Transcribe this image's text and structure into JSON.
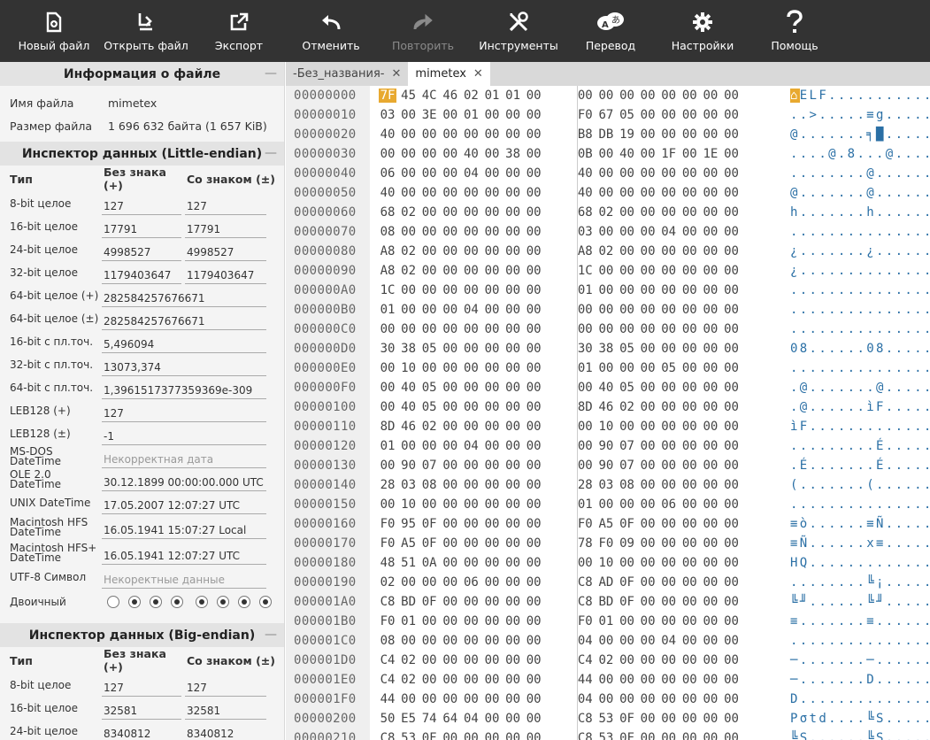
{
  "toolbar": {
    "items": [
      {
        "label": "Новый файл",
        "icon": "new-file-icon"
      },
      {
        "label": "Открыть файл",
        "icon": "open-file-icon"
      },
      {
        "label": "Экспорт",
        "icon": "export-icon"
      },
      {
        "label": "Отменить",
        "icon": "undo-icon"
      },
      {
        "label": "Повторить",
        "icon": "redo-icon"
      },
      {
        "label": "Инструменты",
        "icon": "tools-icon"
      },
      {
        "label": "Перевод",
        "icon": "translate-icon"
      },
      {
        "label": "Настройки",
        "icon": "gear-icon"
      },
      {
        "label": "Помощь",
        "icon": "help-icon"
      }
    ]
  },
  "file_info": {
    "title": "Информация о файле",
    "name_label": "Имя файла",
    "name_value": "mimetex",
    "size_label": "Размер файла",
    "size_value": "1 696 632 байта (1 657 KiB)"
  },
  "inspector_le": {
    "title": "Инспектор данных (Little-endian)",
    "col_type": "Тип",
    "col_unsigned": "Без знака (+)",
    "col_signed": "Со знаком (±)",
    "rows": [
      {
        "label": "8-bit целое",
        "u": "127",
        "s": "127"
      },
      {
        "label": "16-bit целое",
        "u": "17791",
        "s": "17791"
      },
      {
        "label": "24-bit целое",
        "u": "4998527",
        "s": "4998527"
      },
      {
        "label": "32-bit целое",
        "u": "1179403647",
        "s": "1179403647"
      }
    ],
    "wide_rows": [
      {
        "label": "64-bit целое (+)",
        "v": "282584257676671"
      },
      {
        "label": "64-bit целое (±)",
        "v": "282584257676671"
      },
      {
        "label": "16-bit с пл.точ.",
        "v": "5,496094"
      },
      {
        "label": "32-bit с пл.точ.",
        "v": "13073,374"
      },
      {
        "label": "64-bit с пл.точ.",
        "v": "1,3961517377359369e-309"
      },
      {
        "label": "LEB128 (+)",
        "v": "127"
      },
      {
        "label": "LEB128 (±)",
        "v": "-1"
      },
      {
        "label": "MS-DOS DateTime",
        "v": "Некорректная дата"
      },
      {
        "label": "OLE 2.0 DateTime",
        "v": "30.12.1899 00:00:00.000 UTC"
      },
      {
        "label": "UNIX DateTime",
        "v": "17.05.2007 12:07:27 UTC"
      },
      {
        "label": "Macintosh HFS DateTime",
        "v": "16.05.1941 15:07:27 Local"
      },
      {
        "label": "Macintosh HFS+ DateTime",
        "v": "16.05.1941 12:07:27 UTC"
      },
      {
        "label": "UTF-8 Символ",
        "v": "Некоректные данные"
      }
    ],
    "binary_label": "Двоичный",
    "binary_bits": [
      0,
      1,
      1,
      1,
      1,
      1,
      1,
      1
    ]
  },
  "inspector_be": {
    "title": "Инспектор данных (Big-endian)",
    "col_type": "Тип",
    "col_unsigned": "Без знака (+)",
    "col_signed": "Со знаком (±)",
    "rows": [
      {
        "label": "8-bit целое",
        "u": "127",
        "s": "127"
      },
      {
        "label": "16-bit целое",
        "u": "32581",
        "s": "32581"
      },
      {
        "label": "24-bit целое",
        "u": "8340812",
        "s": "8340812"
      }
    ]
  },
  "tabs": [
    {
      "label": "-Без_названия-",
      "active": false
    },
    {
      "label": "mimetex",
      "active": true
    }
  ],
  "hex": {
    "selected": {
      "row": 0,
      "col": 0
    },
    "rows": [
      {
        "a": "00000000",
        "b": "7F 45 4C 46 02 01 01 00 00 00 00 00 00 00 00 00",
        "t": "⌂ELF............"
      },
      {
        "a": "00000010",
        "b": "03 00 3E 00 01 00 00 00 F0 67 05 00 00 00 00 00",
        "t": "..>.....≡g......"
      },
      {
        "a": "00000020",
        "b": "40 00 00 00 00 00 00 00 B8 DB 19 00 00 00 00 00",
        "t": "@.......╕█......"
      },
      {
        "a": "00000030",
        "b": "00 00 00 00 40 00 38 00 0B 00 40 00 1F 00 1E 00",
        "t": "....@.8...@....."
      },
      {
        "a": "00000040",
        "b": "06 00 00 00 04 00 00 00 40 00 00 00 00 00 00 00",
        "t": "........@......."
      },
      {
        "a": "00000050",
        "b": "40 00 00 00 00 00 00 00 40 00 00 00 00 00 00 00",
        "t": "@.......@......."
      },
      {
        "a": "00000060",
        "b": "68 02 00 00 00 00 00 00 68 02 00 00 00 00 00 00",
        "t": "h.......h......."
      },
      {
        "a": "00000070",
        "b": "08 00 00 00 00 00 00 00 03 00 00 00 04 00 00 00",
        "t": "................"
      },
      {
        "a": "00000080",
        "b": "A8 02 00 00 00 00 00 00 A8 02 00 00 00 00 00 00",
        "t": "¿.......¿......."
      },
      {
        "a": "00000090",
        "b": "A8 02 00 00 00 00 00 00 1C 00 00 00 00 00 00 00",
        "t": "¿..............."
      },
      {
        "a": "000000A0",
        "b": "1C 00 00 00 00 00 00 00 01 00 00 00 00 00 00 00",
        "t": "................"
      },
      {
        "a": "000000B0",
        "b": "01 00 00 00 04 00 00 00 00 00 00 00 00 00 00 00",
        "t": "................"
      },
      {
        "a": "000000C0",
        "b": "00 00 00 00 00 00 00 00 00 00 00 00 00 00 00 00",
        "t": "................"
      },
      {
        "a": "000000D0",
        "b": "30 38 05 00 00 00 00 00 30 38 05 00 00 00 00 00",
        "t": "08......08......"
      },
      {
        "a": "000000E0",
        "b": "00 10 00 00 00 00 00 00 01 00 00 00 05 00 00 00",
        "t": "................"
      },
      {
        "a": "000000F0",
        "b": "00 40 05 00 00 00 00 00 00 40 05 00 00 00 00 00",
        "t": ".@.......@......"
      },
      {
        "a": "00000100",
        "b": "00 40 05 00 00 00 00 00 8D 46 02 00 00 00 00 00",
        "t": ".@......ìF......"
      },
      {
        "a": "00000110",
        "b": "8D 46 02 00 00 00 00 00 00 10 00 00 00 00 00 00",
        "t": "ìF.............."
      },
      {
        "a": "00000120",
        "b": "01 00 00 00 04 00 00 00 00 90 07 00 00 00 00 00",
        "t": ".........É......"
      },
      {
        "a": "00000130",
        "b": "00 90 07 00 00 00 00 00 00 90 07 00 00 00 00 00",
        "t": ".É.......É......"
      },
      {
        "a": "00000140",
        "b": "28 03 08 00 00 00 00 00 28 03 08 00 00 00 00 00",
        "t": "(.......(......."
      },
      {
        "a": "00000150",
        "b": "00 10 00 00 00 00 00 00 01 00 00 00 06 00 00 00",
        "t": "................"
      },
      {
        "a": "00000160",
        "b": "F0 95 0F 00 00 00 00 00 F0 A5 0F 00 00 00 00 00",
        "t": "≡ò......≡Ñ......"
      },
      {
        "a": "00000170",
        "b": "F0 A5 0F 00 00 00 00 00 78 F0 09 00 00 00 00 00",
        "t": "≡Ñ......x≡......"
      },
      {
        "a": "00000180",
        "b": "48 51 0A 00 00 00 00 00 00 10 00 00 00 00 00 00",
        "t": "HQ.............."
      },
      {
        "a": "00000190",
        "b": "02 00 00 00 06 00 00 00 C8 AD 0F 00 00 00 00 00",
        "t": "........╚¡......"
      },
      {
        "a": "000001A0",
        "b": "C8 BD 0F 00 00 00 00 00 C8 BD 0F 00 00 00 00 00",
        "t": "╚╜......╚╜......"
      },
      {
        "a": "000001B0",
        "b": "F0 01 00 00 00 00 00 00 F0 01 00 00 00 00 00 00",
        "t": "≡.......≡......."
      },
      {
        "a": "000001C0",
        "b": "08 00 00 00 00 00 00 00 04 00 00 00 04 00 00 00",
        "t": "................"
      },
      {
        "a": "000001D0",
        "b": "C4 02 00 00 00 00 00 00 C4 02 00 00 00 00 00 00",
        "t": "─.......─......."
      },
      {
        "a": "000001E0",
        "b": "C4 02 00 00 00 00 00 00 44 00 00 00 00 00 00 00",
        "t": "─.......D......."
      },
      {
        "a": "000001F0",
        "b": "44 00 00 00 00 00 00 00 04 00 00 00 00 00 00 00",
        "t": "D..............."
      },
      {
        "a": "00000200",
        "b": "50 E5 74 64 04 00 00 00 C8 53 0F 00 00 00 00 00",
        "t": "Pσtd....╚S......"
      },
      {
        "a": "00000210",
        "b": "C8 53 0F 00 00 00 00 00 C8 53 0F 00 00 00 00 00",
        "t": "╚S......╚S......"
      }
    ]
  }
}
